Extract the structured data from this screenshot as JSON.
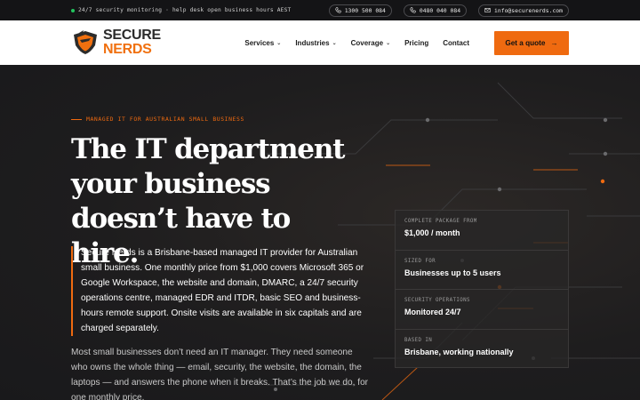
{
  "topbar": {
    "message": "24/7 security monitoring · help desk open business hours AEST",
    "phone1": "1300 500 084",
    "phone2": "0480 040 084",
    "email": "info@securenerds.com"
  },
  "brand": {
    "line1": "SECURE",
    "line2": "NERDS"
  },
  "nav": {
    "items": [
      {
        "label": "Services",
        "has_menu": true
      },
      {
        "label": "Industries",
        "has_menu": true
      },
      {
        "label": "Coverage",
        "has_menu": true
      },
      {
        "label": "Pricing",
        "has_menu": false
      },
      {
        "label": "Contact",
        "has_menu": false
      }
    ],
    "cta_label": "Get a quote",
    "cta_arrow": "→",
    "chevron": "⌄"
  },
  "hero": {
    "eyebrow": "MANAGED IT FOR AUSTRALIAN SMALL BUSINESS",
    "headline": [
      "The IT department",
      "your business",
      "doesn’t have to hire."
    ],
    "lead": "Secure Nerds is a Brisbane-based managed IT provider for Australian small business. One monthly price from $1,000 covers Microsoft 365 or Google Workspace, the website and domain, DMARC, a 24/7 security operations centre, managed EDR and ITDR, basic SEO and business-hours remote support. Onsite visits are available in six capitals and are charged separately.",
    "body": "Most small businesses don’t need an IT manager. They need someone who owns the whole thing — email, security, the website, the domain, the laptops — and answers the phone when it breaks. That’s the job we do, for one monthly price."
  },
  "facts": [
    {
      "label": "COMPLETE PACKAGE FROM",
      "value": "$1,000 / month"
    },
    {
      "label": "SIZED FOR",
      "value": "Businesses up to 5 users"
    },
    {
      "label": "SECURITY OPERATIONS",
      "value": "Monitored 24/7"
    },
    {
      "label": "BASED IN",
      "value": "Brisbane, working nationally"
    }
  ],
  "colors": {
    "accent": "#ef6a10",
    "status_dot": "#22c55e",
    "dark_bg": "#1b1b1d"
  },
  "icons": {
    "phone": "phone-icon",
    "mail": "mail-icon",
    "arrow": "arrow-right-icon"
  }
}
